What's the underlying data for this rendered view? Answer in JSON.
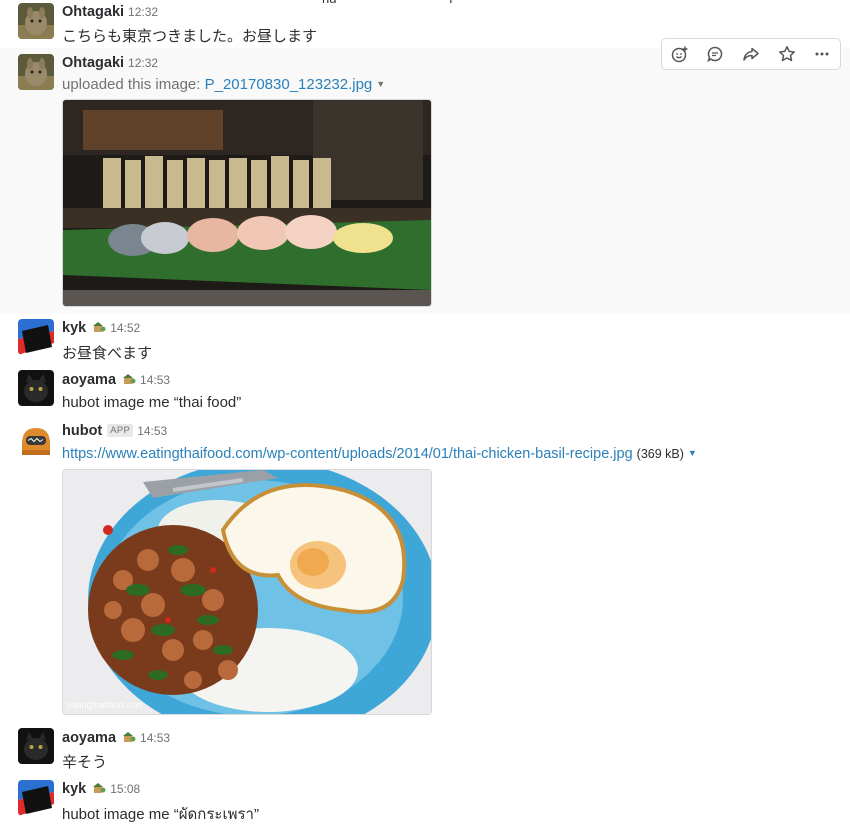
{
  "top_fragment": {
    "left": "ng",
    "right": "ı"
  },
  "messages": [
    {
      "sender": "Ohtagaki",
      "time": "12:32",
      "text": "こちらも東京つきました。お昼します"
    },
    {
      "sender": "Ohtagaki",
      "time": "12:32",
      "upload_prefix": "uploaded this image:",
      "filename": "P_20170830_123232.jpg",
      "image_caption": "sushi platter photo"
    },
    {
      "sender": "kyk",
      "time": "14:52",
      "text": "お昼食べます"
    },
    {
      "sender": "aoyama",
      "time": "14:53",
      "text": "hubot image me “thai food”"
    },
    {
      "sender": "hubot",
      "badge": "APP",
      "time": "14:53",
      "url": "https://www.eatingthaifood.com/wp-content/uploads/2014/01/thai-chicken-basil-recipe.jpg",
      "size": "(369 kB)",
      "watermark": "eatingthaifood.com"
    },
    {
      "sender": "aoyama",
      "time": "14:53",
      "text": "辛そう"
    },
    {
      "sender": "kyk",
      "time": "15:08",
      "text": "hubot image me “ผัดกระเพรา”"
    }
  ],
  "message_actions": {
    "items": [
      {
        "icon": "add-reaction-icon"
      },
      {
        "icon": "comment-icon"
      },
      {
        "icon": "share-icon"
      },
      {
        "icon": "star-icon"
      },
      {
        "icon": "more-icon"
      }
    ]
  },
  "colors": {
    "link": "#2a80b9",
    "text": "#2c2d30",
    "muted": "#717274",
    "hover_bg": "#f9f9f9"
  }
}
